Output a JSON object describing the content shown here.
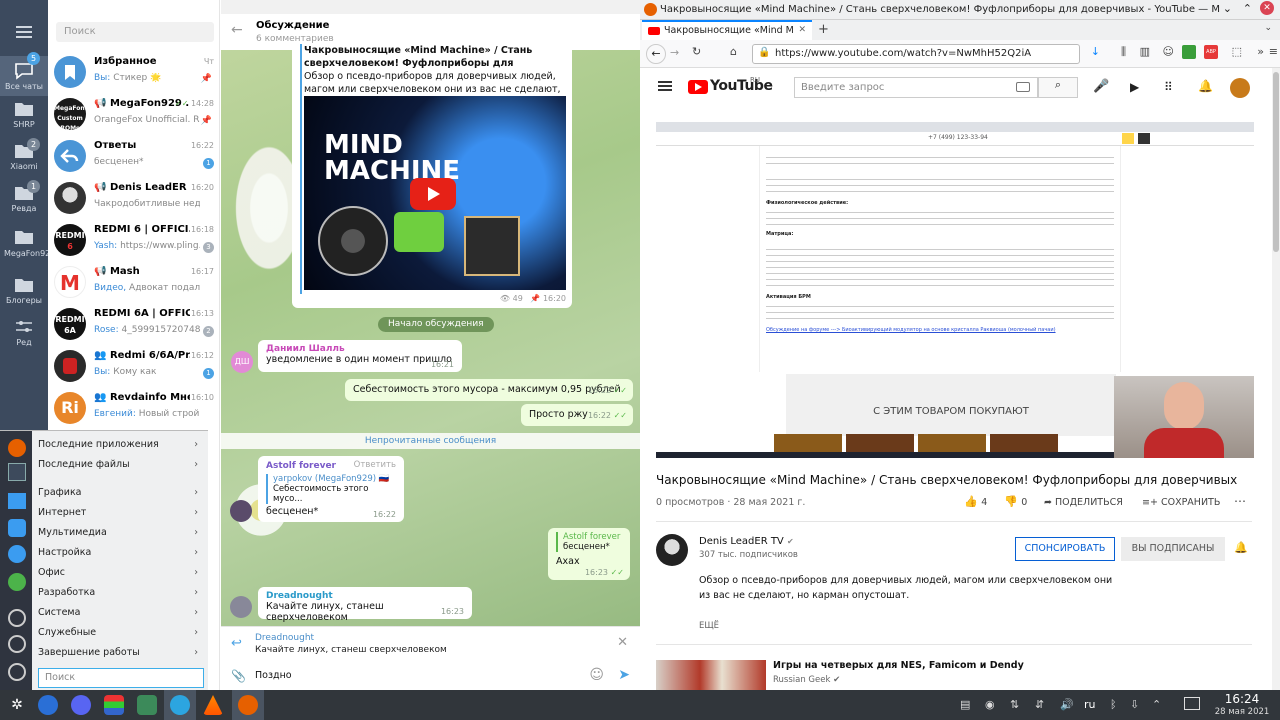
{
  "telegram": {
    "rail": [
      {
        "label": "Все чаты",
        "badge": "5"
      },
      {
        "label": "SHRP",
        "badge": ""
      },
      {
        "label": "Xiaomi",
        "badge": "2"
      },
      {
        "label": "Ревда",
        "badge": "1"
      },
      {
        "label": "MegaFon929",
        "badge": ""
      },
      {
        "label": "Блогеры",
        "badge": ""
      },
      {
        "label": "Ред",
        "badge": ""
      }
    ],
    "search_placeholder": "Поиск",
    "chats": [
      {
        "name": "Избранное",
        "time": "Чт",
        "preview_sender": "Вы:",
        "preview": "Стикер 🌟",
        "badge": "",
        "avatar": "bookmark",
        "color": "#4a95d6"
      },
      {
        "name": "MegaFon929 ...",
        "time": "14:28",
        "preview_sender": "",
        "preview": "OrangeFox Unofficial. R...",
        "badge": "",
        "avatar": "mf",
        "color": "#1a1a1a"
      },
      {
        "name": "Ответы",
        "time": "16:22",
        "preview_sender": "",
        "preview": "бесценен*",
        "badge": "1",
        "avatar": "reply",
        "color": "#4a95d6"
      },
      {
        "name": "Denis LeadER ...",
        "time": "16:20",
        "preview_sender": "",
        "preview": "Чакродобитливые недо...",
        "badge": "",
        "avatar": "dl",
        "color": "#444"
      },
      {
        "name": "REDMI 6 | OFFICI...",
        "time": "16:18",
        "preview_sender": "Yash:",
        "preview": "https://www.pling....",
        "badge": "3",
        "avatar": "r6",
        "color": "#111"
      },
      {
        "name": "Mash",
        "time": "16:17",
        "preview_sender": "Видео,",
        "preview": "Адвокат подал ...",
        "badge": "",
        "avatar": "M",
        "color": "#fff"
      },
      {
        "name": "REDMI 6A | OFFIC...",
        "time": "16:13",
        "preview_sender": "Rose:",
        "preview": "4_5999157207487...",
        "badge": "2",
        "avatar": "6A",
        "color": "#111"
      },
      {
        "name": "Redmi 6/6A/Pr...",
        "time": "16:12",
        "preview_sender": "Вы:",
        "preview": "Кому как",
        "badge": "1",
        "avatar": "rp",
        "color": "#222"
      },
      {
        "name": "Revdainfo Мнения",
        "time": "16:10",
        "preview_sender": "Евгений:",
        "preview": "Новый стройк...",
        "badge": "",
        "avatar": "Ri",
        "color": "#e8862a"
      }
    ],
    "header": {
      "title": "Обсуждение",
      "subtitle": "6 комментариев"
    },
    "post": {
      "title": "Чакровыносящие «Mind Machine» / Стань сверхчеловеком! Фуфлоприборы для доверчивых",
      "text": "Обзор о псевдо-приборов для доверчивых людей, магом или сверхчеловеком они из вас не сделают, но карман опустош...",
      "thumb_title": "MIND MACHINE",
      "views": "49",
      "time": "16:20"
    },
    "discussion_start": "Начало обсуждения",
    "messages": [
      {
        "author": "Даниил Шалль",
        "text": "уведомление в один момент пришло",
        "time": "16:21",
        "avatar": "ДШ"
      },
      {
        "text": "Себестоимость этого мусора - максимум 0,95 рублей",
        "time": "16:22"
      },
      {
        "text": "Просто ржу",
        "time": "16:22"
      }
    ],
    "unread": "Непрочитанные сообщения",
    "reply_msg": {
      "author": "Astolf forever",
      "reply_btn": "Ответить",
      "quote_author": "yarpokov (MegaFon929) 🇷🇺",
      "quote_text": "Себестоимость этого мусо...",
      "text": "бесценен*",
      "time": "16:22"
    },
    "out_reply": {
      "quote_author": "Astolf forever",
      "quote_text": "бесценен*",
      "text": "Ахах",
      "time": "16:23"
    },
    "dread_msg": {
      "author": "Dreadnought",
      "text": "Качайте линух, станеш сверхчеловеком",
      "time": "16:23"
    },
    "compose": {
      "reply_author": "Dreadnought",
      "reply_text": "Качайте линух, станеш сверхчеловеком",
      "input": "Поздно"
    }
  },
  "startmenu": {
    "items": [
      "Последние приложения",
      "Последние файлы",
      "Графика",
      "Интернет",
      "Мультимедиа",
      "Настройка",
      "Офис",
      "Разработка",
      "Система",
      "Служебные",
      "Завершение работы"
    ],
    "search_placeholder": "Поиск"
  },
  "firefox": {
    "window_title": "Чакровыносящие «Mind Machine» / Стань сверхчеловеком! Фуфлоприборы для доверчивых - YouTube — Mozilla Firefox",
    "tab_title": "Чакровыносящие «Mind M",
    "url": "https://www.youtube.com/watch?v=NwMhH52Q2iA",
    "addon_badge": "ABP",
    "youtube": {
      "logo": "YouTube",
      "logo_region": "RU",
      "search_placeholder": "Введите запрос",
      "video_title": "Чакровыносящие «Mind Machine» / Стань сверхчеловеком! Фуфлоприборы для доверчивых",
      "views": "0 просмотров · 28 мая 2021 г.",
      "likes": "4",
      "dislikes": "0",
      "share": "ПОДЕЛИТЬСЯ",
      "save": "СОХРАНИТЬ",
      "channel": "Denis LeadER TV",
      "subs": "307 тыс. подписчиков",
      "sponsor": "СПОНСИРОВАТЬ",
      "subscribed": "ВЫ ПОДПИСАНЫ",
      "description": "Обзор о псевдо-приборов для доверчивых людей, магом или сверхчеловеком они из вас не сделают, но карман опустошат.",
      "more": "ЕЩЁ",
      "rec_title": "Игры на четверых для NES, Famicom и Dendy",
      "rec_channel": "Russian Geek",
      "frame_phone": "+7 (499) 123-33-94",
      "frame_heading": "Физиологическое действие:",
      "frame_matrix": "Матрица:",
      "frame_activation": "Активация БРМ",
      "frame_link": "Обсуждение на форуме ---> Биоактивирующий модулятор на основе кристалла Раквиоша (молочный пачаи)",
      "frame_buy": "С ЭТИМ ТОВАРОМ ПОКУПАЮТ"
    }
  },
  "taskbar": {
    "lang": "ru",
    "time": "16:24",
    "date": "28 мая 2021"
  }
}
